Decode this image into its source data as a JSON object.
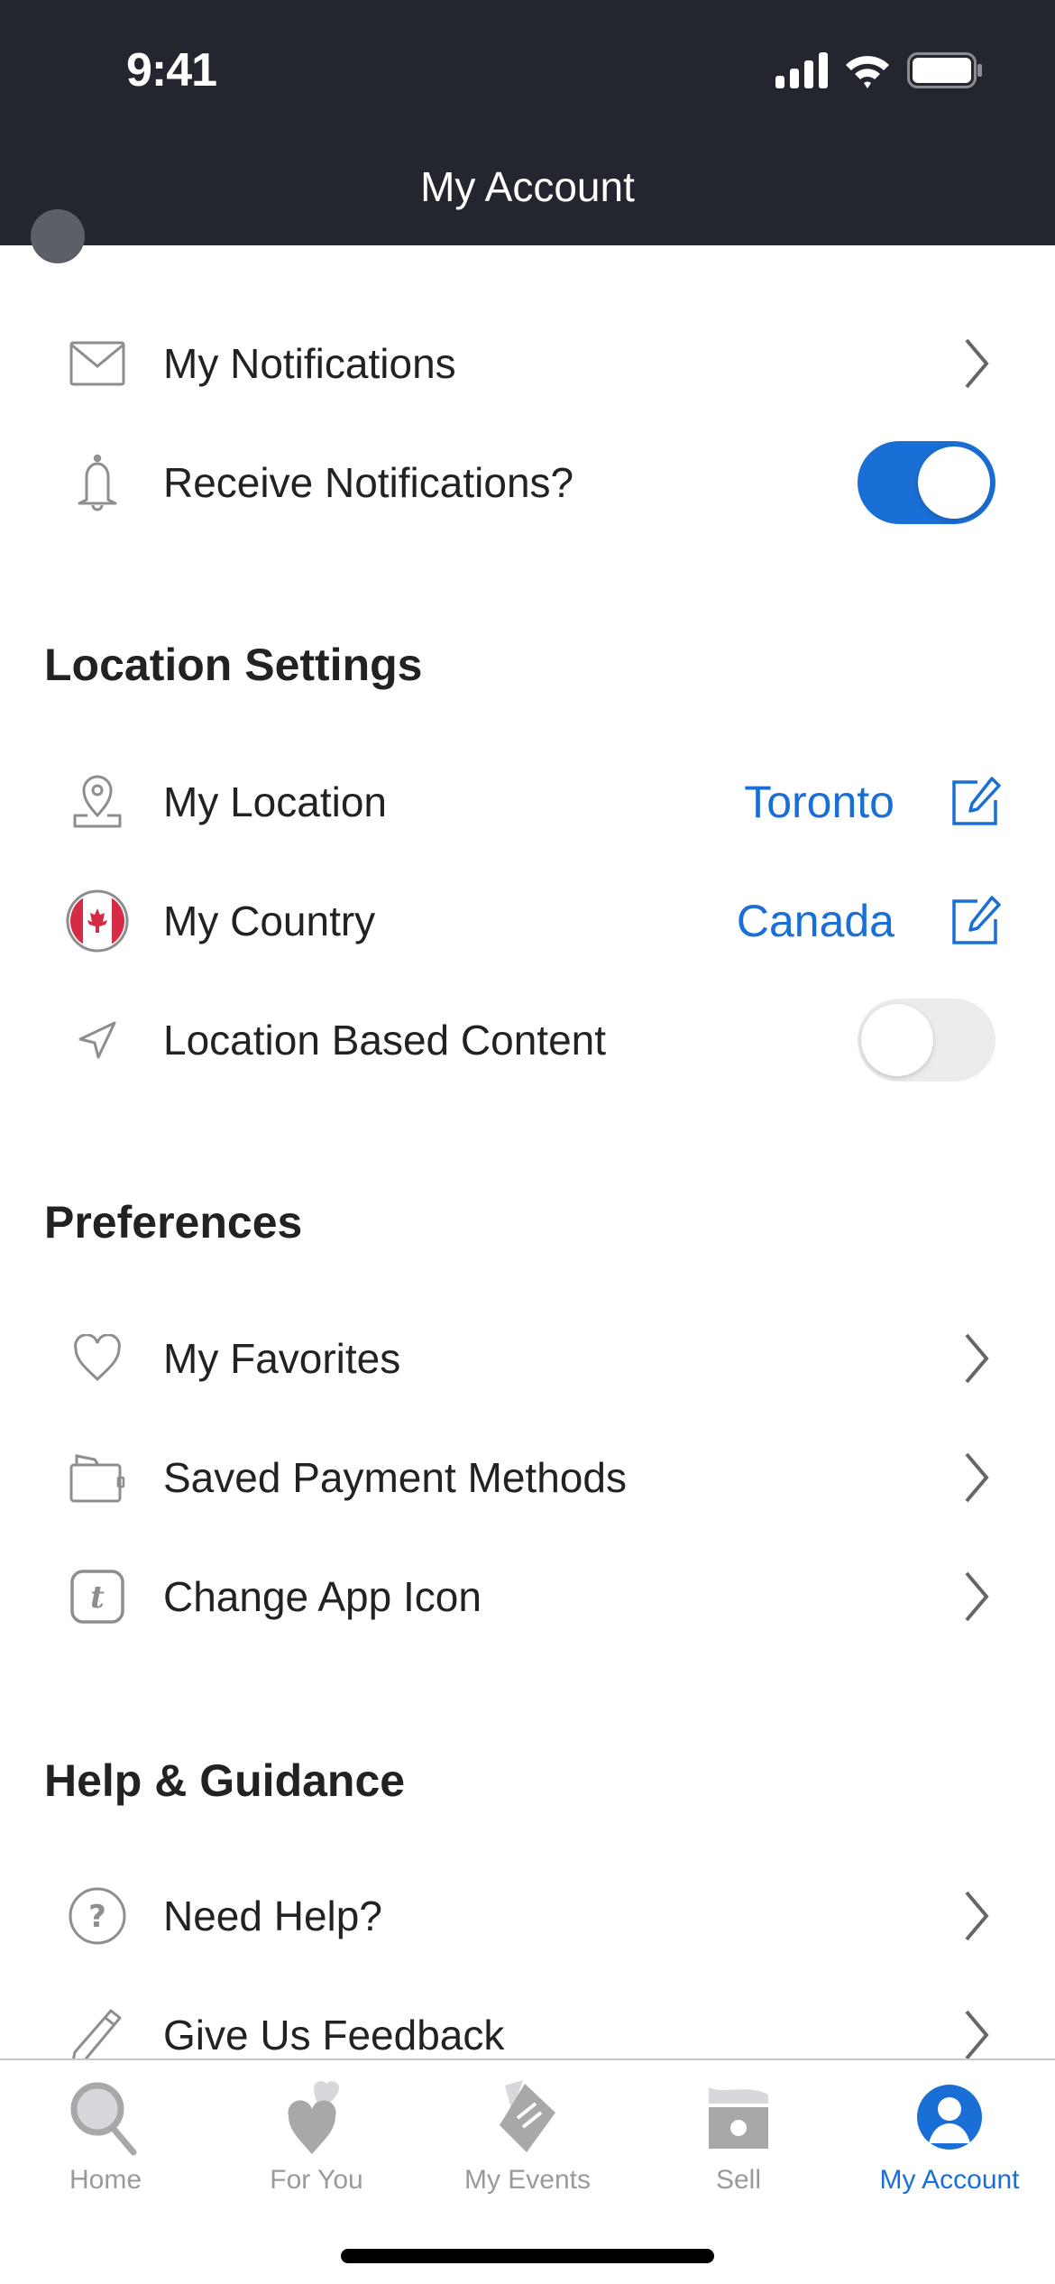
{
  "status_bar": {
    "time": "9:41"
  },
  "header": {
    "title": "My Account"
  },
  "notifications": [
    {
      "label": "My Notifications",
      "icon": "envelope-icon",
      "accessory": "chevron"
    },
    {
      "label": "Receive Notifications?",
      "icon": "bell-icon",
      "accessory": "toggle",
      "toggle_on": true
    }
  ],
  "location_settings": {
    "title": "Location Settings",
    "items": [
      {
        "label": "My Location",
        "icon": "location-pin-icon",
        "value": "Toronto"
      },
      {
        "label": "My Country",
        "icon": "canada-flag-icon",
        "value": "Canada"
      },
      {
        "label": "Location Based Content",
        "icon": "navigation-arrow-icon",
        "toggle_on": false
      }
    ]
  },
  "preferences": {
    "title": "Preferences",
    "items": [
      {
        "label": "My Favorites",
        "icon": "heart-icon"
      },
      {
        "label": "Saved Payment Methods",
        "icon": "wallet-icon"
      },
      {
        "label": "Change App Icon",
        "icon": "app-icon-t-icon",
        "glyph": "t"
      }
    ]
  },
  "help": {
    "title": "Help & Guidance",
    "items": [
      {
        "label": "Need Help?",
        "icon": "question-circle-icon"
      },
      {
        "label": "Give Us Feedback",
        "icon": "pencil-icon"
      }
    ]
  },
  "tabbar": {
    "tabs": [
      {
        "label": "Home",
        "icon": "search-icon",
        "active": false
      },
      {
        "label": "For You",
        "icon": "hearts-icon",
        "active": false
      },
      {
        "label": "My Events",
        "icon": "ticket-icon",
        "active": false
      },
      {
        "label": "Sell",
        "icon": "money-icon",
        "active": false
      },
      {
        "label": "My Account",
        "icon": "account-icon",
        "active": true
      }
    ]
  },
  "colors": {
    "header_bg": "#23262e",
    "accent": "#1a6fd6",
    "icon_gray": "#8e8e8e",
    "text": "#222222"
  }
}
